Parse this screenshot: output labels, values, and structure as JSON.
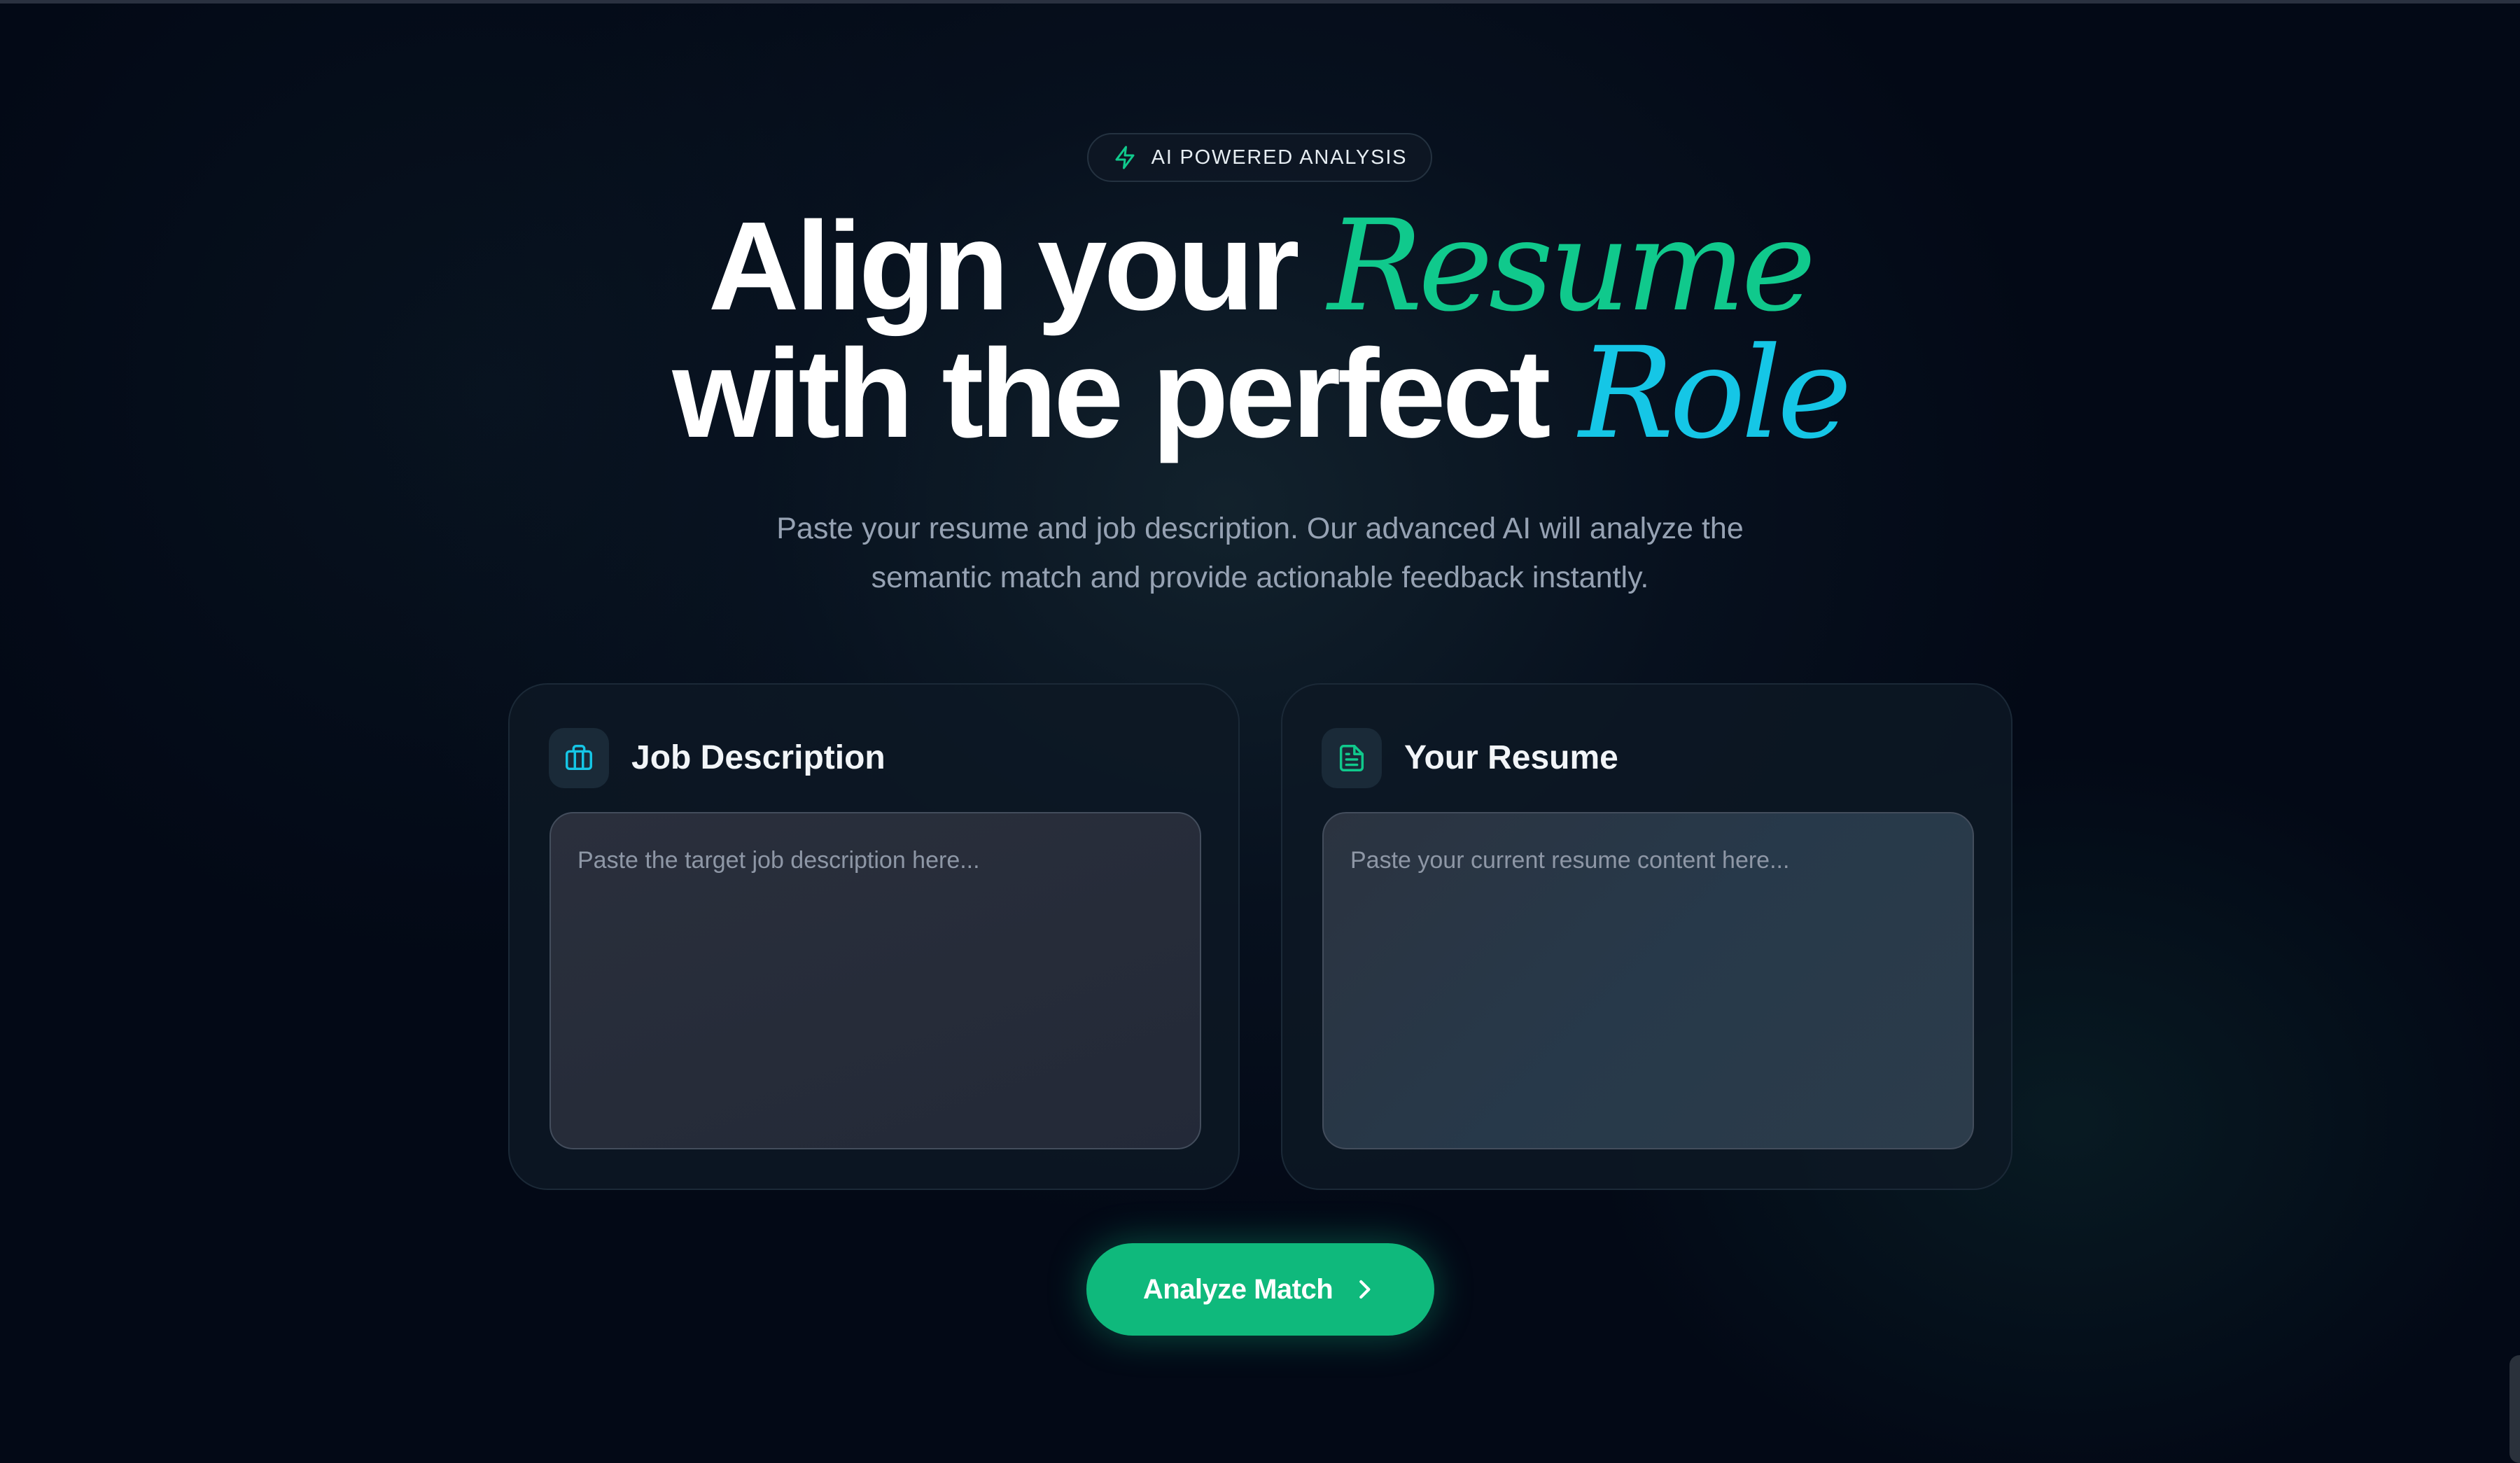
{
  "badge": {
    "icon": "lightning-icon",
    "label": "AI POWERED ANALYSIS"
  },
  "hero": {
    "line1_prefix": "Align your",
    "line1_accent": "Resume",
    "line2_prefix": "with the perfect",
    "line2_accent": "Role"
  },
  "subtitle": {
    "line1": "Paste your resume and job description. Our advanced AI will analyze the",
    "line2": "semantic match and provide actionable feedback instantly."
  },
  "cards": {
    "job": {
      "icon": "briefcase-icon",
      "title": "Job Description",
      "placeholder": "Paste the target job description here...",
      "value": ""
    },
    "resume": {
      "icon": "document-icon",
      "title": "Your Resume",
      "placeholder": "Paste your current resume content here...",
      "value": ""
    }
  },
  "action": {
    "label": "Analyze Match",
    "icon": "chevron-right-icon"
  },
  "colors": {
    "background": "#030916",
    "accent_green": "#10c98c",
    "accent_cyan": "#15c6e6",
    "button": "#0fb97c",
    "heading": "#ffffff",
    "muted_text": "#96a2b3"
  }
}
